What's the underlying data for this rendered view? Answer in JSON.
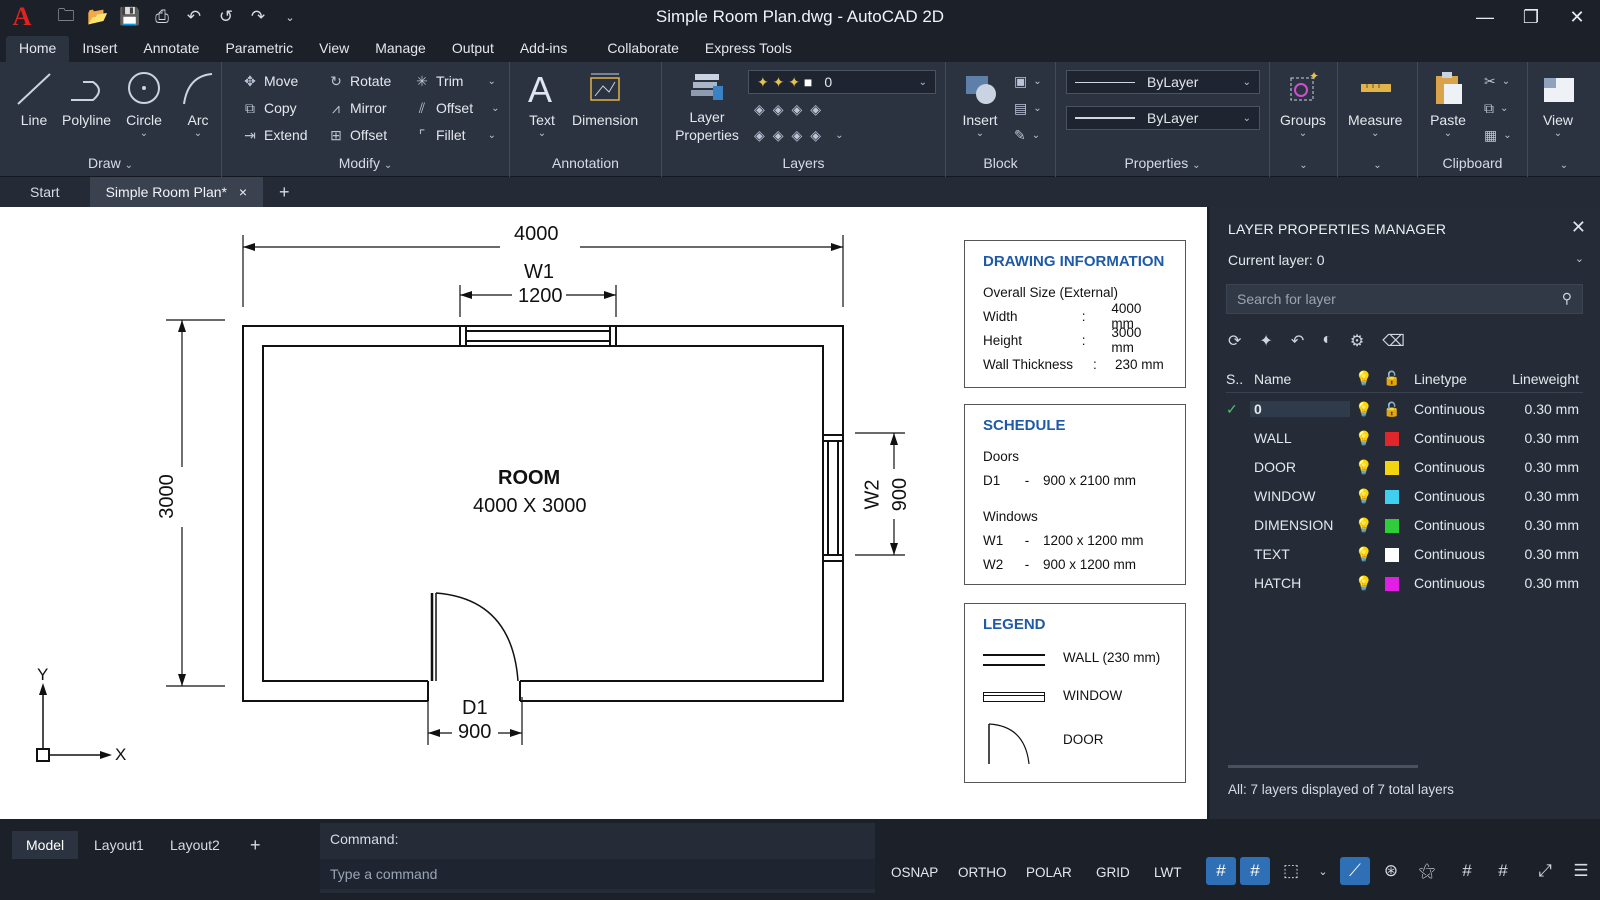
{
  "app": {
    "title": "Simple Room Plan.dwg - AutoCAD 2D",
    "logo": "A"
  },
  "menu_tabs": [
    "Home",
    "Insert",
    "Annotate",
    "Parametric",
    "View",
    "Manage",
    "Output",
    "Add-ins",
    "Collaborate",
    "Express Tools"
  ],
  "ribbon": {
    "draw": {
      "title": "Draw",
      "line": "Line",
      "polyline": "Polyline",
      "circle": "Circle",
      "arc": "Arc"
    },
    "modify": {
      "title": "Modify",
      "move": "Move",
      "rotate": "Rotate",
      "trim": "Trim",
      "copy": "Copy",
      "mirror": "Mirror",
      "offset1": "Offset",
      "extend": "Extend",
      "offset2": "Offset",
      "fillet": "Fillet"
    },
    "annotation": {
      "title": "Annotation",
      "text": "Text",
      "dimension": "Dimension"
    },
    "layers": {
      "title": "Layers",
      "layer_properties": "Layer Properties",
      "current": "0"
    },
    "block": {
      "title": "Block",
      "insert": "Insert"
    },
    "properties": {
      "title": "Properties",
      "color": "ByLayer",
      "linetype": "ByLayer"
    },
    "groups": "Groups",
    "measure": "Measure",
    "clipboard": {
      "title": "Clipboard",
      "paste": "Paste"
    },
    "view": "View"
  },
  "doc_tabs": {
    "start": "Start",
    "active": "Simple Room Plan*",
    "close": "×",
    "add": "+"
  },
  "drawing": {
    "overall_width": "4000",
    "overall_height": "3000",
    "w1_label": "W1",
    "w1_size": "1200",
    "w2_label": "W2",
    "w2_size": "900",
    "d1_label": "D1",
    "d1_size": "900",
    "room_title": "ROOM",
    "room_size": "4000 X 3000",
    "axis_y": "Y",
    "axis_x": "X"
  },
  "info": {
    "title": "DRAWING INFORMATION",
    "subtitle": "Overall Size (External)",
    "rows": [
      {
        "k": "Width",
        "sep": ":",
        "v": "4000 mm"
      },
      {
        "k": "Height",
        "sep": ":",
        "v": "3000 mm"
      },
      {
        "k": "Wall Thickness",
        "sep": ":",
        "v": "230 mm"
      }
    ]
  },
  "schedule": {
    "title": "SCHEDULE",
    "doors_title": "Doors",
    "doors": [
      {
        "id": "D1",
        "sep": "-",
        "size": "900 x 2100 mm"
      }
    ],
    "windows_title": "Windows",
    "windows": [
      {
        "id": "W1",
        "sep": "-",
        "size": "1200 x 1200 mm"
      },
      {
        "id": "W2",
        "sep": "-",
        "size": "900 x 1200 mm"
      }
    ]
  },
  "legend": {
    "title": "LEGEND",
    "wall": "WALL (230 mm)",
    "window": "WINDOW",
    "door": "DOOR"
  },
  "layer_manager": {
    "title": "LAYER PROPERTIES MANAGER",
    "current": "Current layer: 0",
    "search_placeholder": "Search for layer",
    "columns": {
      "status": "S..",
      "name": "Name",
      "linetype": "Linetype",
      "lineweight": "Lineweight"
    },
    "layers": [
      {
        "name": "0",
        "color": "#ffffff",
        "linetype": "Continuous",
        "lineweight": "0.30 mm",
        "current": true
      },
      {
        "name": "WALL",
        "color": "#e0262b",
        "linetype": "Continuous",
        "lineweight": "0.30 mm"
      },
      {
        "name": "DOOR",
        "color": "#f2d410",
        "linetype": "Continuous",
        "lineweight": "0.30 mm"
      },
      {
        "name": "WINDOW",
        "color": "#3fd0ef",
        "linetype": "Continuous",
        "lineweight": "0.30 mm"
      },
      {
        "name": "DIMENSION",
        "color": "#2fcd3a",
        "linetype": "Continuous",
        "lineweight": "0.30 mm"
      },
      {
        "name": "TEXT",
        "color": "#ffffff",
        "linetype": "Continuous",
        "lineweight": "0.30 mm"
      },
      {
        "name": "HATCH",
        "color": "#e21ee4",
        "linetype": "Continuous",
        "lineweight": "0.30 mm"
      }
    ],
    "footer": "All: 7 layers displayed of 7 total layers"
  },
  "layout_tabs": [
    "Model",
    "Layout1",
    "Layout2"
  ],
  "command": {
    "label": "Command:",
    "placeholder": "Type  a  command"
  },
  "status": {
    "osnap": "OSNAP",
    "ortho": "ORTHO",
    "polar": "POLAR",
    "grid": "GRID",
    "lwt": "LWT"
  },
  "colors": {
    "accent": "#2f6fb5",
    "info_title": "#1f5aa8",
    "ribbon_bg": "#2c3340"
  }
}
